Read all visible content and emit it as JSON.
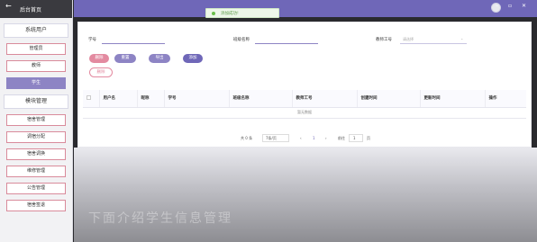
{
  "sidebar": {
    "back_icon": "back-arrow-icon",
    "title": "后台首页",
    "section1": "系统用户",
    "users": [
      "管理员",
      "教师",
      "学生"
    ],
    "active_user": "学生",
    "section2": "模块管理",
    "modules": [
      "宿舍管理",
      "调宿分配",
      "宿舍调换",
      "维修管理",
      "公告管理",
      "宿舍签退"
    ]
  },
  "toast": {
    "text": "添加成功!"
  },
  "form": {
    "label1": "学号",
    "label2": "班级名称",
    "label3": "教师工号",
    "placeholder3": "请选择"
  },
  "buttons": {
    "delete": "删除",
    "reset": "重置",
    "import": "导出",
    "add": "添加",
    "batch_delete": "删除"
  },
  "table": {
    "headers": [
      "用户名",
      "昵称",
      "学号",
      "班级名称",
      "教师工号",
      "创建时间",
      "更新时间",
      "操作"
    ],
    "empty_text": "暂无数据"
  },
  "pager": {
    "total": "共 0 条",
    "per_page": "7条/页",
    "page": "1",
    "goto_prefix": "前往",
    "goto_value": "1",
    "goto_suffix": "页"
  },
  "overlay": {
    "text": "下面介绍学生信息管理"
  },
  "colors": {
    "accent": "#6f67b8",
    "pink": "#e38aa0",
    "purple": "#8d84c4"
  }
}
